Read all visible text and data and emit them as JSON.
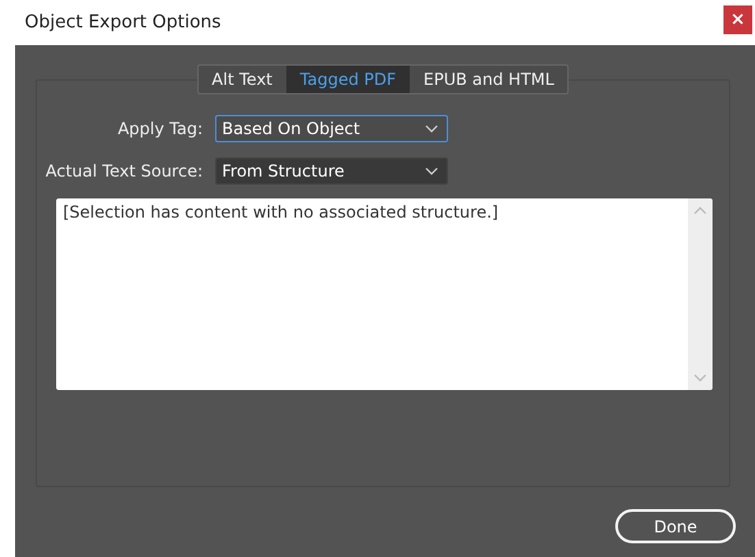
{
  "window": {
    "title": "Object Export Options",
    "close": "×"
  },
  "tabs": [
    {
      "label": "Alt Text",
      "selected": false
    },
    {
      "label": "Tagged PDF",
      "selected": true
    },
    {
      "label": "EPUB and HTML",
      "selected": false
    }
  ],
  "fields": [
    {
      "label": "Apply Tag:",
      "value": "Based On Object",
      "focused": true
    },
    {
      "label": "Actual Text Source:",
      "value": "From Structure",
      "focused": false
    }
  ],
  "text_box": {
    "value": "[Selection has content with no associated structure.]"
  },
  "buttons": [
    "Done"
  ]
}
